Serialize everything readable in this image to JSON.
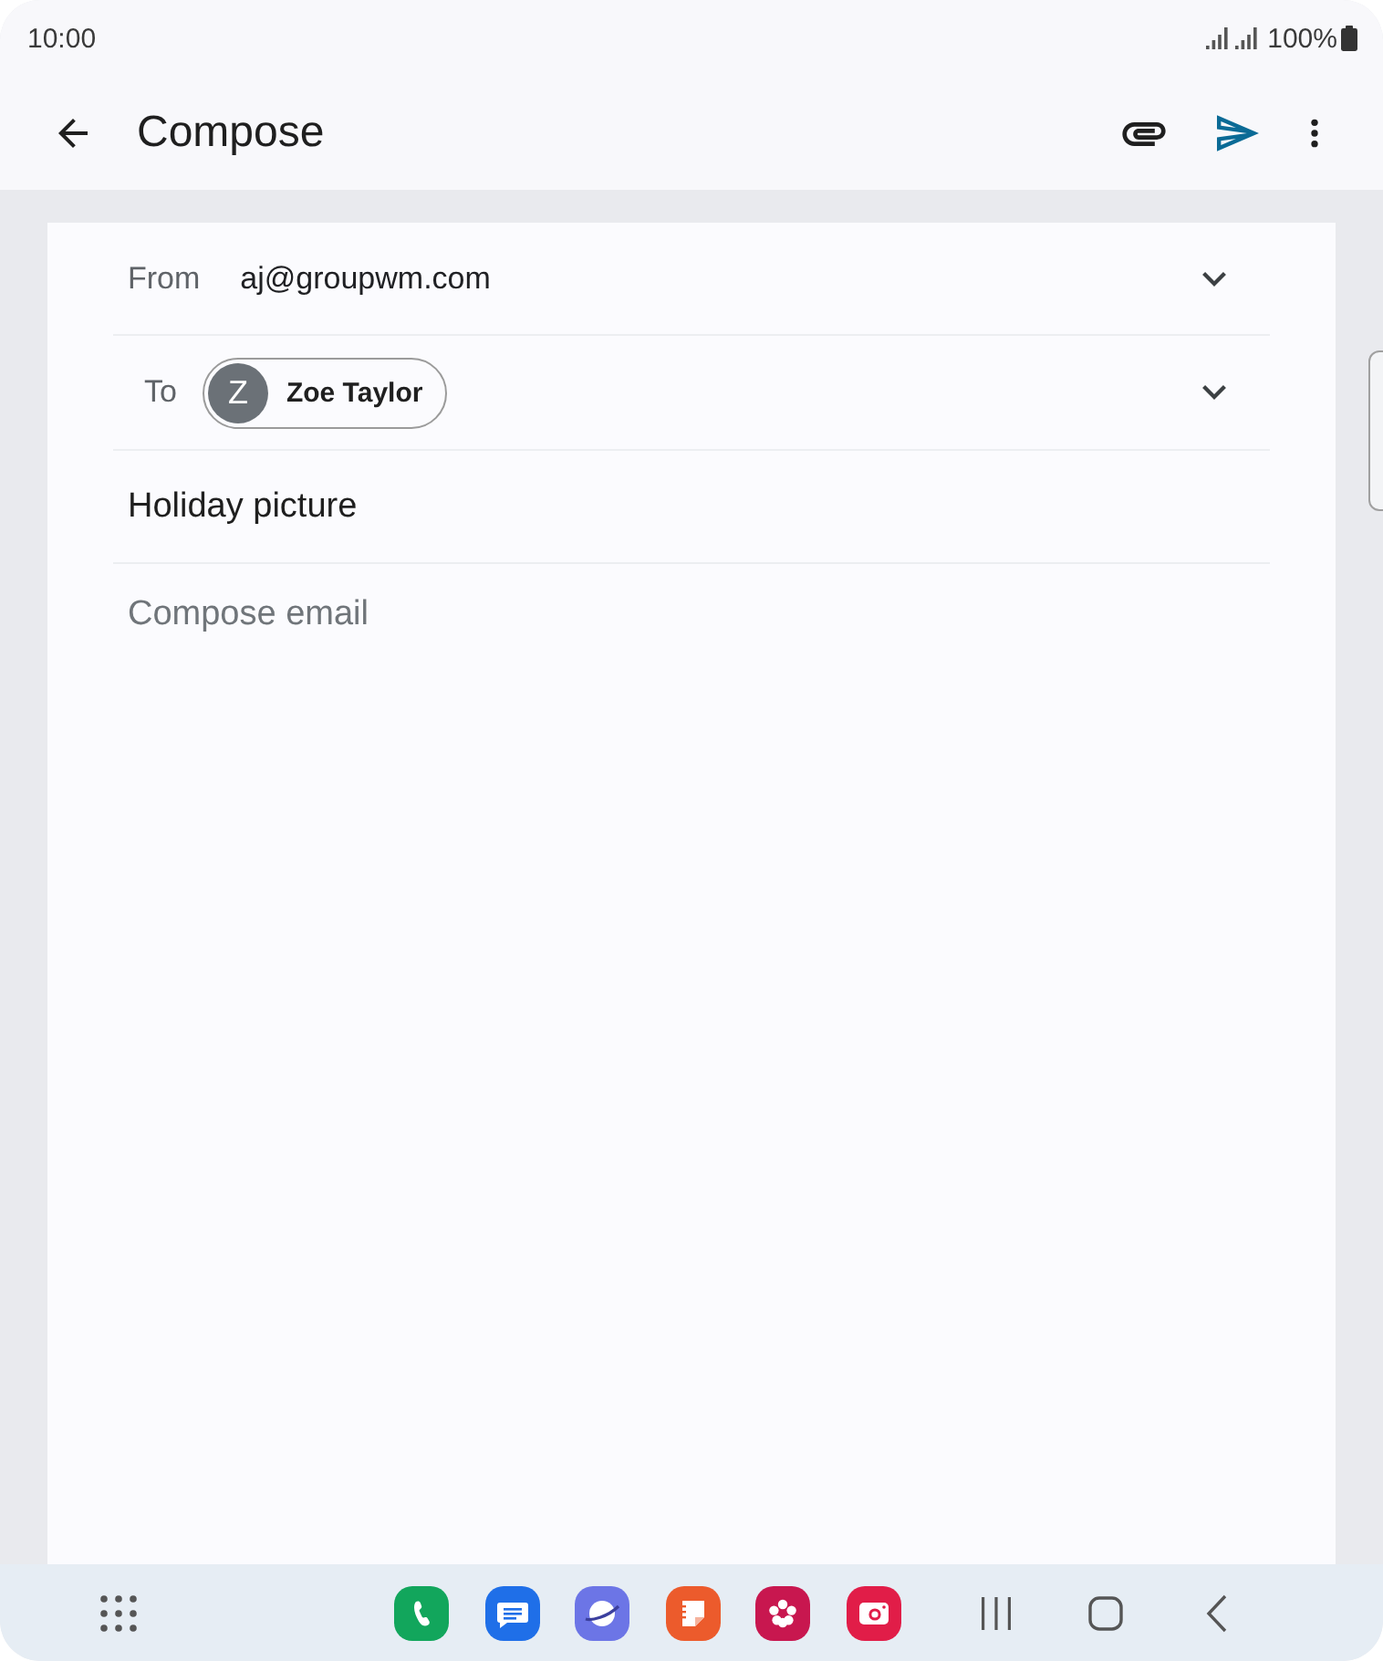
{
  "status_bar": {
    "time": "10:00",
    "battery": "100%"
  },
  "app_bar": {
    "title": "Compose"
  },
  "form": {
    "from": {
      "label": "From",
      "value": "aj@groupwm.com"
    },
    "to": {
      "label": "To",
      "recipients": [
        {
          "initial": "Z",
          "name": "Zoe Taylor"
        }
      ]
    },
    "subject": {
      "value": "Holiday picture"
    },
    "body": {
      "placeholder": "Compose email"
    }
  },
  "dock": {
    "apps": [
      {
        "kind": "phone"
      },
      {
        "kind": "messages"
      },
      {
        "kind": "internet"
      },
      {
        "kind": "notes"
      },
      {
        "kind": "gallery"
      },
      {
        "kind": "camera"
      }
    ]
  }
}
